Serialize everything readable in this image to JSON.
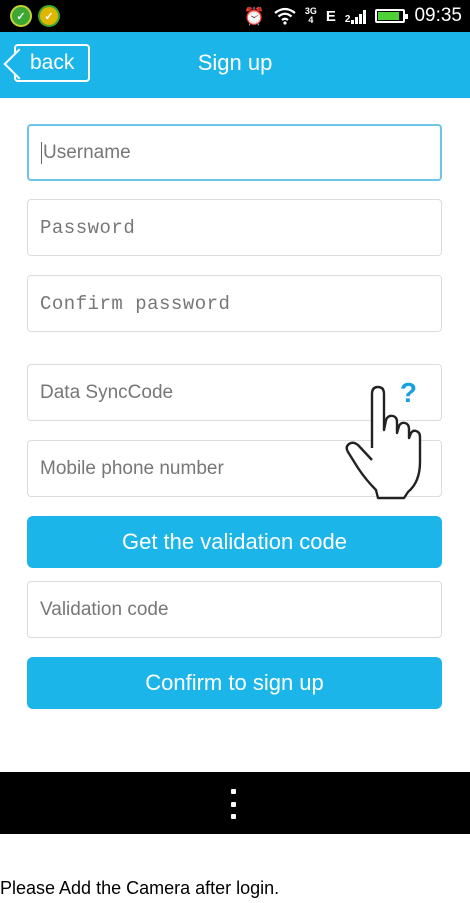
{
  "status_bar": {
    "signal_label_top": "3G",
    "signal_label_bottom": "4",
    "network": "E",
    "network_small": "2",
    "battery_level": 0.85,
    "time": "09:35"
  },
  "header": {
    "back_label": "back",
    "title": "Sign up"
  },
  "form": {
    "username_placeholder": "Username",
    "password_placeholder": "Password",
    "confirm_password_placeholder": "Confirm password",
    "data_synccode_placeholder": "Data SyncCode",
    "help_symbol": "?",
    "mobile_placeholder": "Mobile phone number",
    "get_code_label": "Get the validation code",
    "validation_code_placeholder": "Validation code",
    "confirm_signup_label": "Confirm to sign up"
  },
  "caption": "Please Add the Camera after login.",
  "colors": {
    "accent": "#1cb5ea",
    "help": "#1aa0e0"
  },
  "icons": [
    "app-icon",
    "alarm-icon",
    "wifi-icon",
    "signal-icon",
    "battery-icon",
    "chevron-left-icon",
    "help-icon",
    "hand-pointer-icon",
    "menu-dots-icon"
  ]
}
